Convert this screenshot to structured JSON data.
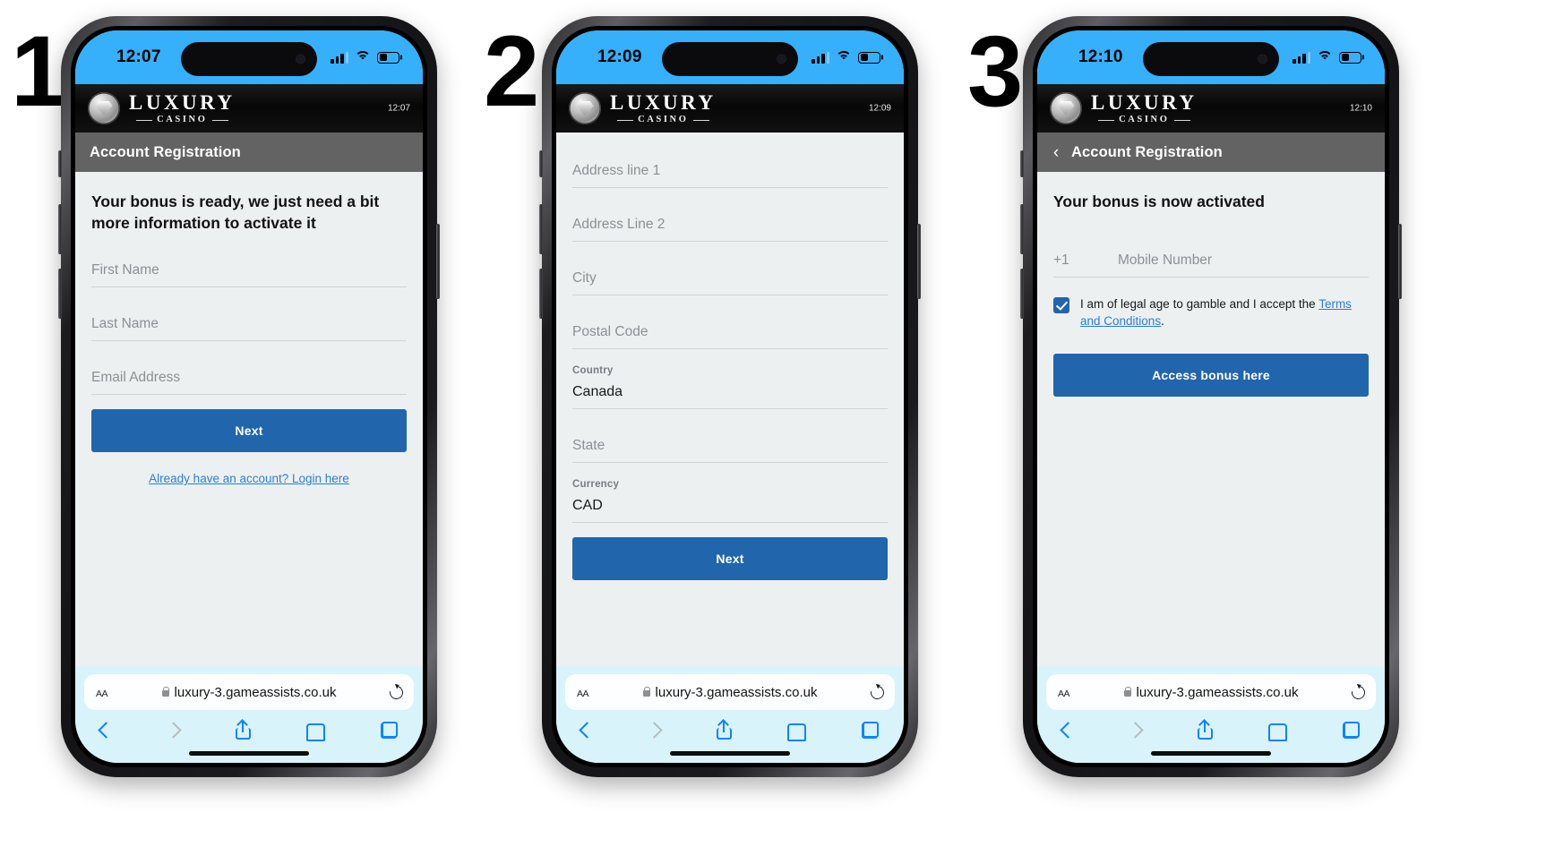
{
  "steps": [
    {
      "number": "1"
    },
    {
      "number": "2"
    },
    {
      "number": "3"
    }
  ],
  "brand": {
    "name_line1": "LUXURY",
    "name_line2": "CASINO",
    "logo_icon": "diamond-icon"
  },
  "colors": {
    "status_bar": "#36b0fb",
    "page_bar": "#636363",
    "body_bg": "#edf0f1",
    "primary_button": "#2165ac",
    "link": "#2b7fd4",
    "safari_bg": "#d9f3fa"
  },
  "phones": [
    {
      "id": "phone-1",
      "status": {
        "time": "12:07",
        "signal_icon": "cellular-signal-icon",
        "wifi_icon": "wifi-icon",
        "battery_icon": "battery-icon"
      },
      "header_time": "12:07",
      "page_title": "Account Registration",
      "has_back": false,
      "heading": "Your bonus is ready, we just need a bit more information to activate it",
      "fields": [
        {
          "placeholder": "First Name",
          "value": "",
          "label": ""
        },
        {
          "placeholder": "Last Name",
          "value": "",
          "label": ""
        },
        {
          "placeholder": "Email Address",
          "value": "",
          "label": ""
        }
      ],
      "primary_button": "Next",
      "login_link": "Already have an account? Login here",
      "safari": {
        "aa_label": "AA",
        "lock_icon": "lock-icon",
        "url": "luxury-3.gameassists.co.uk",
        "reload_icon": "reload-icon",
        "nav": {
          "back": "back-chevron-icon",
          "forward": "forward-chevron-icon",
          "share": "share-icon",
          "bookmarks": "book-icon",
          "tabs": "tabs-icon"
        }
      }
    },
    {
      "id": "phone-2",
      "status": {
        "time": "12:09",
        "signal_icon": "cellular-signal-icon",
        "wifi_icon": "wifi-icon",
        "battery_icon": "battery-icon"
      },
      "header_time": "12:09",
      "page_title": "",
      "has_back": false,
      "heading": "",
      "fields": [
        {
          "placeholder": "Address line 1",
          "value": "",
          "label": ""
        },
        {
          "placeholder": "Address Line 2",
          "value": "",
          "label": ""
        },
        {
          "placeholder": "City",
          "value": "",
          "label": ""
        },
        {
          "placeholder": "Postal Code",
          "value": "",
          "label": ""
        },
        {
          "placeholder": "",
          "value": "Canada",
          "label": "Country"
        },
        {
          "placeholder": "State",
          "value": "",
          "label": ""
        },
        {
          "placeholder": "",
          "value": "CAD",
          "label": "Currency"
        }
      ],
      "primary_button": "Next",
      "login_link": "",
      "safari": {
        "aa_label": "AA",
        "lock_icon": "lock-icon",
        "url": "luxury-3.gameassists.co.uk",
        "reload_icon": "reload-icon",
        "nav": {
          "back": "back-chevron-icon",
          "forward": "forward-chevron-icon",
          "share": "share-icon",
          "bookmarks": "book-icon",
          "tabs": "tabs-icon"
        }
      }
    },
    {
      "id": "phone-3",
      "status": {
        "time": "12:10",
        "signal_icon": "cellular-signal-icon",
        "wifi_icon": "wifi-icon",
        "battery_icon": "battery-icon"
      },
      "header_time": "12:10",
      "page_title": "Account Registration",
      "has_back": true,
      "heading": "Your bonus is now activated",
      "phone_field": {
        "country_code": "+1",
        "placeholder": "Mobile Number"
      },
      "terms": {
        "checked": true,
        "text_before": "I am of legal age to gamble and I accept the ",
        "link_text": "Terms and Conditions",
        "text_after": "."
      },
      "primary_button": "Access bonus here",
      "safari": {
        "aa_label": "AA",
        "lock_icon": "lock-icon",
        "url": "luxury-3.gameassists.co.uk",
        "reload_icon": "reload-icon",
        "nav": {
          "back": "back-chevron-icon",
          "forward": "forward-chevron-icon",
          "share": "share-icon",
          "bookmarks": "book-icon",
          "tabs": "tabs-icon"
        }
      }
    }
  ]
}
